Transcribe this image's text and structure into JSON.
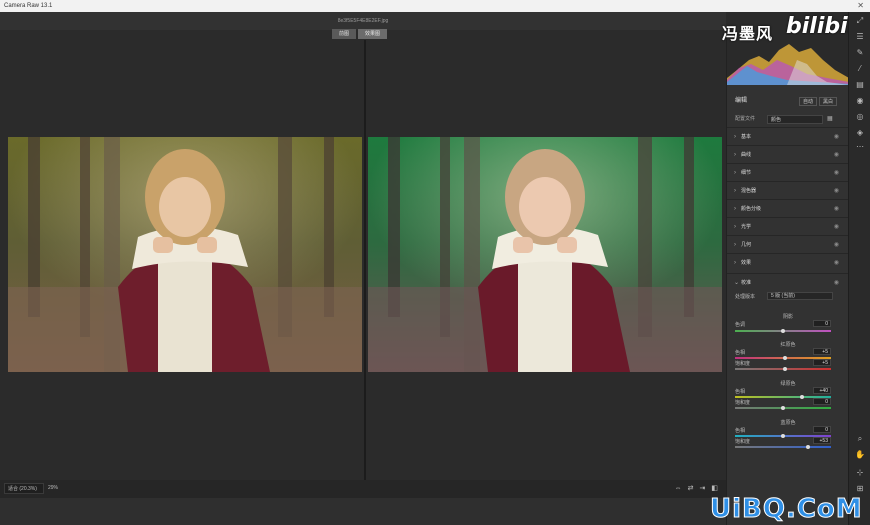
{
  "window": {
    "title": "Camera Raw 13.1",
    "close_glyph": "✕"
  },
  "document": {
    "filename": "8e3f5E5F4E8E2EF.jpg"
  },
  "view_tabs": [
    {
      "label": "前图"
    },
    {
      "label": "效果图"
    }
  ],
  "bottom": {
    "zoom_field": "适合 (20.3%)",
    "zoom_select": "29%",
    "icons": [
      "swap-icon",
      "cycle-icon",
      "copy-settings-icon",
      "before-after-layout-icon"
    ]
  },
  "watermark": {
    "name": "冯墨风",
    "brand": "bilibili",
    "site": "UiBQ.CoM"
  },
  "panel": {
    "edit_title": "编辑",
    "auto_label": "自动",
    "bw_label": "黑白",
    "profile_label": "配置文件",
    "profile_value": "颜色",
    "sections": [
      {
        "label": "基本"
      },
      {
        "label": "曲线"
      },
      {
        "label": "细节"
      },
      {
        "label": "混色器"
      },
      {
        "label": "颜色分级"
      },
      {
        "label": "光学"
      },
      {
        "label": "几何"
      },
      {
        "label": "效果"
      }
    ],
    "calibration": {
      "title": "校准",
      "process_label": "处理版本",
      "process_value": "5 版 (当前)",
      "shadows_title": "阴影",
      "shadows_tint_label": "色调",
      "shadows_tint_value": "0",
      "red_title": "红原色",
      "red_hue_label": "色相",
      "red_hue_value": "+5",
      "red_sat_label": "饱和度",
      "red_sat_value": "+5",
      "green_title": "绿原色",
      "green_hue_label": "色相",
      "green_hue_value": "+40",
      "green_sat_label": "饱和度",
      "green_sat_value": "0",
      "blue_title": "蓝原色",
      "blue_hue_label": "色相",
      "blue_hue_value": "0",
      "blue_sat_label": "饱和度",
      "blue_sat_value": "+53"
    }
  },
  "toolbar": {
    "tools": [
      "expand-icon",
      "sliders-icon",
      "healing-icon",
      "brush-icon",
      "gradient-icon",
      "radial-icon",
      "redeye-icon",
      "presets-icon",
      "more-icon",
      "zoom-icon",
      "hand-icon",
      "sampler-icon",
      "grid-icon"
    ]
  },
  "colors": {
    "panel_bg": "#323232",
    "canvas_bg": "#2b2b2b",
    "uibq_blue": "#2f8fe6"
  }
}
